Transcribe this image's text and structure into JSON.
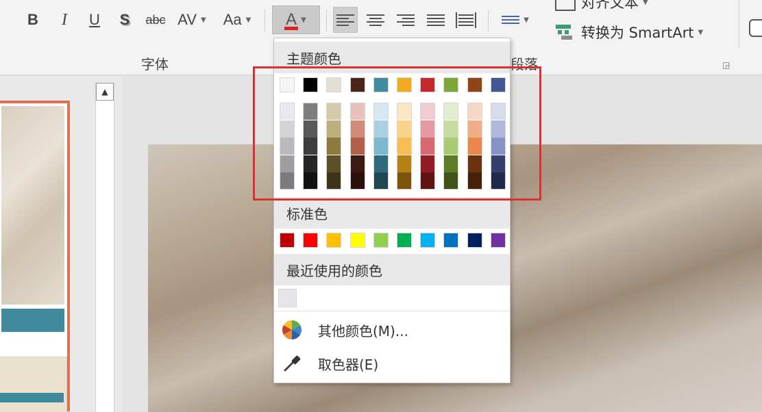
{
  "ribbon": {
    "font_buttons": {
      "bold": "B",
      "italic": "I",
      "underline": "U",
      "shadow": "S",
      "strikethrough": "abc",
      "spacing": "AV",
      "change_case": "Aa",
      "font_color": "A"
    },
    "font_group_label": "字体",
    "paragraph_group_label_partial": "段落",
    "align_text_label_partial": "对齐文本",
    "convert_smartart_label": "转换为 SmartArt"
  },
  "palette": {
    "theme_header": "主题颜色",
    "theme_top_row": [
      "#F5F5F8",
      "#000000",
      "#E3DDD3",
      "#4B2419",
      "#3F8CA0",
      "#F1AA22",
      "#C1292F",
      "#7EA636",
      "#8E4414",
      "#435595"
    ],
    "theme_shades": [
      [
        "#E8E8EE",
        "#D4D4D8",
        "#B9B9BE",
        "#9D9DA2",
        "#7A7A7F"
      ],
      [
        "#7E7E7E",
        "#595959",
        "#3D3D3D",
        "#262626",
        "#111111"
      ],
      [
        "#D4C9A9",
        "#BFAF7C",
        "#8E7A3F",
        "#5E5026",
        "#3C3418"
      ],
      [
        "#E7C2BA",
        "#CF8A7A",
        "#B45E4C",
        "#3B1A12",
        "#2A1009"
      ],
      [
        "#D5E8F1",
        "#A9D1E2",
        "#7CB9D1",
        "#2F6B7A",
        "#1F4752"
      ],
      [
        "#FCE7C4",
        "#F9D28C",
        "#F6BD55",
        "#B68016",
        "#7A540D"
      ],
      [
        "#F1CCD0",
        "#E49AA0",
        "#D76870",
        "#8F1D22",
        "#611316"
      ],
      [
        "#E2EDCF",
        "#C6DBA0",
        "#A9C973",
        "#5E7C28",
        "#3F531A"
      ],
      [
        "#F8D7C4",
        "#F1AF88",
        "#EB874D",
        "#6A320E",
        "#462109"
      ],
      [
        "#D7DBEC",
        "#AEB8D9",
        "#8594C7",
        "#323F6F",
        "#212A4A"
      ]
    ],
    "standard_header": "标准色",
    "standard_colors": [
      "#C00000",
      "#FF0000",
      "#FFC000",
      "#FFFF00",
      "#92D050",
      "#00B050",
      "#00B0F0",
      "#0070C0",
      "#002060",
      "#7030A0"
    ],
    "recent_header": "最近使用的颜色",
    "recent_colors": [
      "#E6E6EA"
    ],
    "more_colors": "其他颜色(M)...",
    "eyedropper": "取色器(E)"
  },
  "icons": {
    "more_colors": "color-wheel-icon",
    "eyedropper": "eyedropper-icon",
    "scroll_up": "scroll-up-arrow-icon",
    "smartart": "smartart-icon"
  }
}
